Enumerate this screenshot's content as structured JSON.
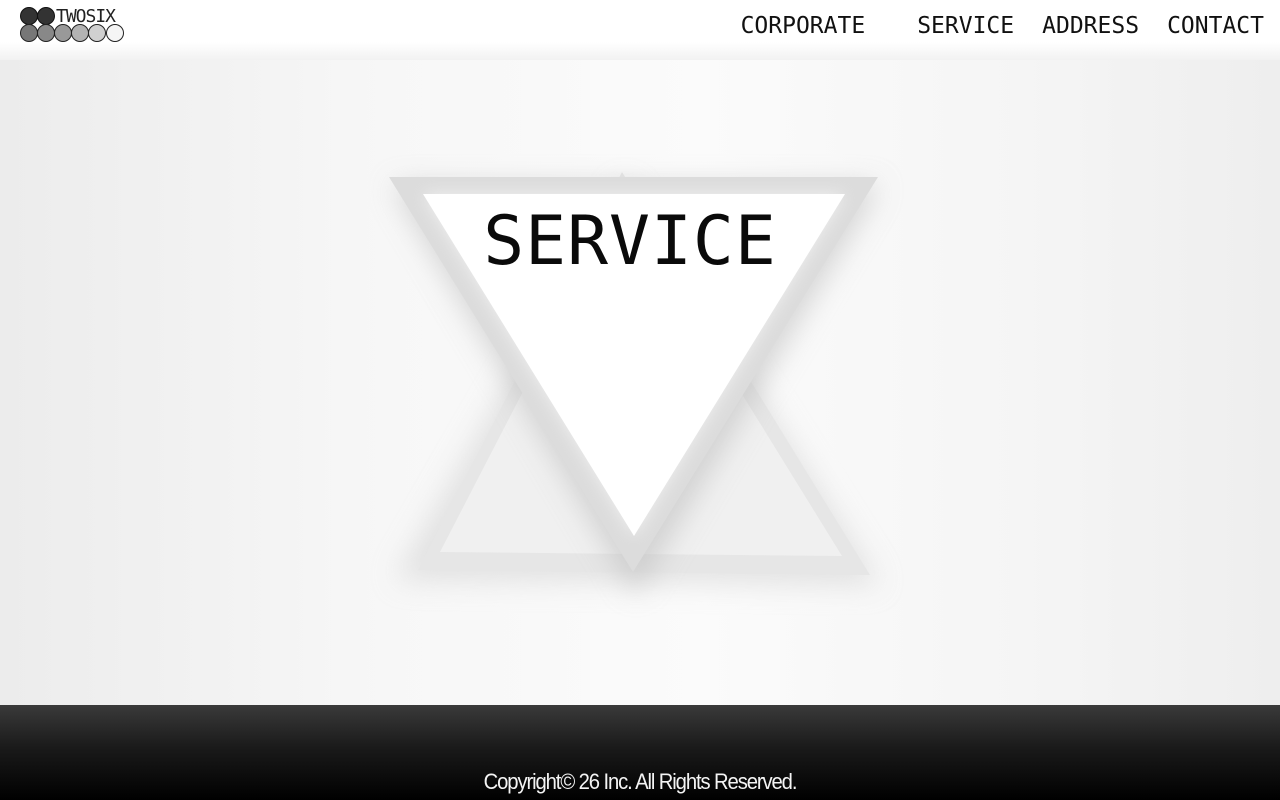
{
  "header": {
    "logo_text": "TWOSIX"
  },
  "nav": {
    "items": [
      {
        "label": "CORPORATE"
      },
      {
        "label": "SERVICE"
      },
      {
        "label": "ADDRESS"
      },
      {
        "label": "CONTACT"
      }
    ]
  },
  "hero": {
    "title": "SERVICE"
  },
  "footer": {
    "copyright": "Copyright© 26 Inc. All Rights Reserved."
  },
  "colors": {
    "footer_bg": "#111111",
    "text": "#111111",
    "triangle_border": "#dcdcdc"
  }
}
